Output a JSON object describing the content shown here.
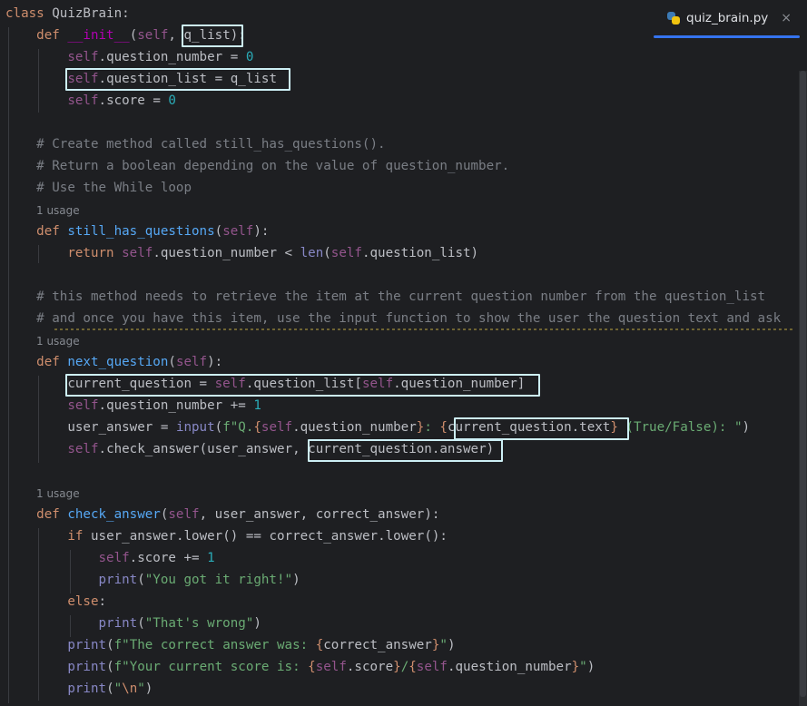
{
  "tab": {
    "filename": "quiz_brain.py",
    "close_glyph": "×",
    "icon": "python-file-icon"
  },
  "usage_hint": "1 usage",
  "code": {
    "l1_class": "class",
    "l1_name": "QuizBrain:",
    "def": "def",
    "init_name": "__init__",
    "self": "self",
    "q_list": "q_list",
    "question_number": "question_number",
    "question_list": "question_list",
    "score": "score",
    "zero": "0",
    "one": "1",
    "comment1": "# Create method called still_has_questions().",
    "comment2": "# Return a boolean depending on the value of question_number.",
    "comment3": "# Use the While loop",
    "still_has_questions": "still_has_questions",
    "return": "return",
    "len": "len",
    "comment4": "# this method needs to retrieve the item at the current question number from the question_list",
    "comment5": "# and once you have this item, use the input function to show the user the question text and ask",
    "next_question": "next_question",
    "current_question": "current_question",
    "user_answer": "user_answer",
    "input": "input",
    "fstr_q_start": "f\"Q.",
    "fstr_colon": ": ",
    "cq_text": "current_question.text",
    "fstr_tf": " (True/False): \"",
    "check_answer": "check_answer",
    "cq_answer": "current_question.answer",
    "correct_answer": "correct_answer",
    "if": "if",
    "else": "else",
    "lower": "lower",
    "print": "print",
    "str_right": "\"You got it right!\"",
    "str_wrong": "\"That's wrong\"",
    "fstr_correct": "f\"The correct answer was: ",
    "fstr_score": "f\"Your current score is: ",
    "str_newline_q": "\"",
    "newline_esc": "\\n"
  }
}
